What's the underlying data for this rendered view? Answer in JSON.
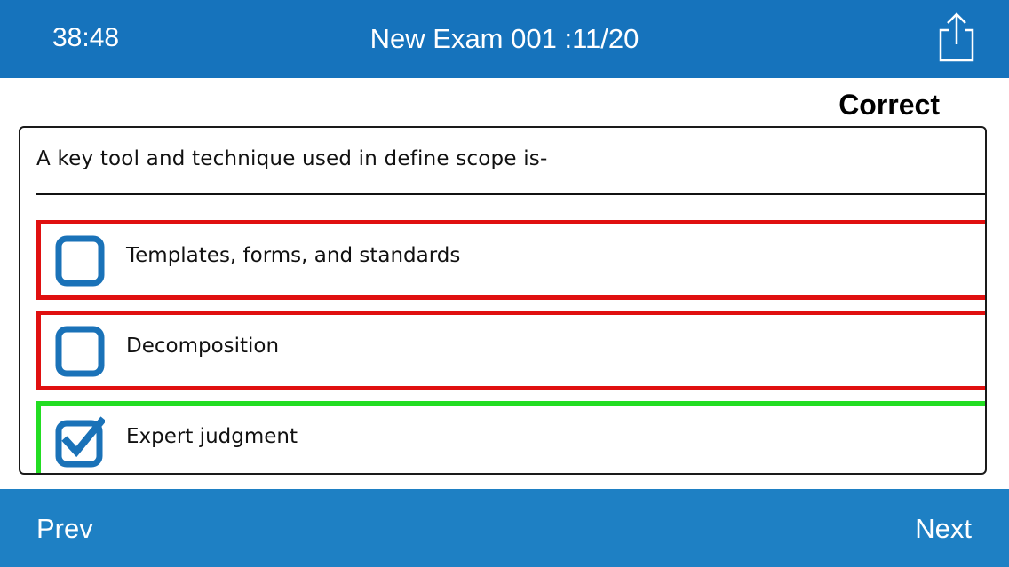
{
  "header": {
    "timer": "38:48",
    "title": "New Exam 001 :11/20",
    "share_icon": "share-icon"
  },
  "result": "Correct",
  "question": {
    "text": "A key tool and technique used in define scope is-",
    "options": [
      {
        "label": "Templates, forms, and standards",
        "checked": false,
        "status": "incorrect"
      },
      {
        "label": "Decomposition",
        "checked": false,
        "status": "incorrect"
      },
      {
        "label": "Expert judgment",
        "checked": true,
        "status": "correct"
      }
    ]
  },
  "footer": {
    "prev_label": "Prev",
    "next_label": "Next"
  },
  "colors": {
    "bar": "#1673bc",
    "incorrect_border": "#e01010",
    "correct_border": "#22dd22",
    "checkbox": "#1a72b8"
  }
}
